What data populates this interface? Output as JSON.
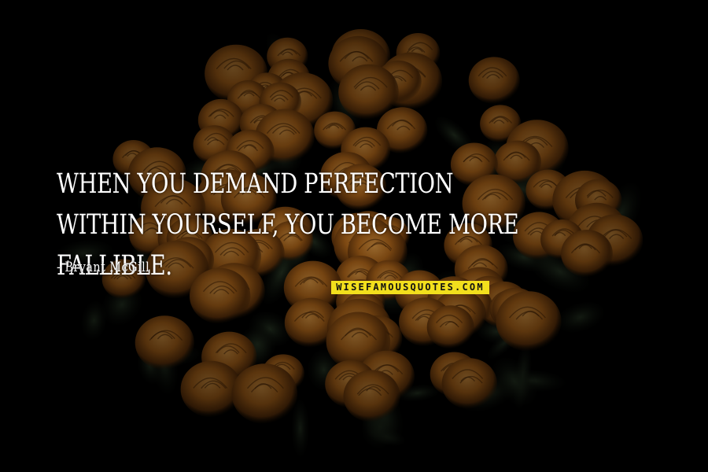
{
  "quote": {
    "text": "When you demand perfection within yourself, you become more fallible.",
    "author": "- Bryant McGill"
  },
  "watermark": {
    "text": "WISEFAMOUSQUOTES.COM"
  },
  "colors": {
    "background": "#000000",
    "text": "#ffffff",
    "watermark_bg": "#f2df1d",
    "rose_orange": "#c8761f",
    "leaf_green": "#223322"
  }
}
